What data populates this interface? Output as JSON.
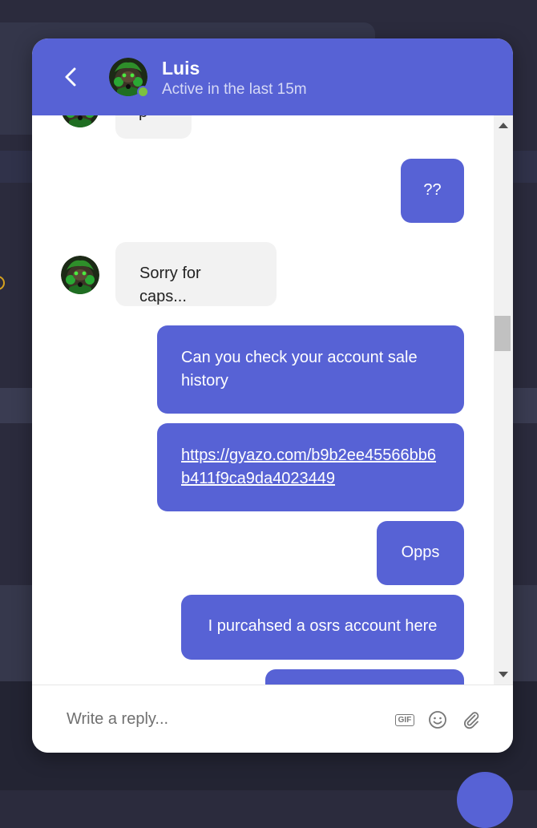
{
  "header": {
    "name": "Luis",
    "status": "Active in the last 15m"
  },
  "messages": [
    {
      "side": "in",
      "text": "p"
    },
    {
      "side": "out",
      "text": "??"
    },
    {
      "side": "in",
      "text": "Sorry for caps..."
    },
    {
      "side": "out",
      "text": "Can you check your account sale history"
    },
    {
      "side": "out",
      "text": "https://gyazo.com/b9b2ee45566bb6b411f9ca9da4023449",
      "is_link": true
    },
    {
      "side": "out",
      "text": "Opps"
    },
    {
      "side": "out",
      "text": "I purcahsed a osrs account here"
    },
    {
      "side": "out",
      "text": ""
    }
  ],
  "composer": {
    "placeholder": "Write a reply...",
    "gif_label": "GIF"
  },
  "colors": {
    "accent": "#5762d5",
    "incoming_bubble": "#f2f2f2",
    "online": "#7cc142"
  },
  "icons": [
    "back-arrow-icon",
    "gif-icon",
    "emoji-icon",
    "attachment-icon"
  ]
}
